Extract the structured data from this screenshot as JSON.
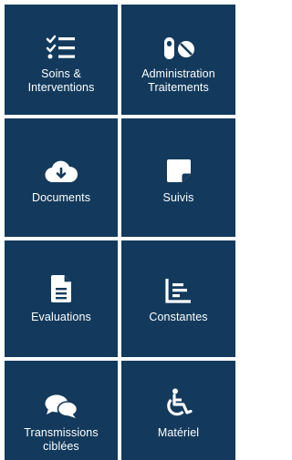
{
  "tiles": [
    {
      "label": "Soins &\nInterventions",
      "icon": "checklist-icon"
    },
    {
      "label": "Administration\nTraitements",
      "icon": "pills-icon"
    },
    {
      "label": "Documents",
      "icon": "cloud-download-icon"
    },
    {
      "label": "Suivis",
      "icon": "sticky-note-icon"
    },
    {
      "label": "Evaluations",
      "icon": "document-icon"
    },
    {
      "label": "Constantes",
      "icon": "bar-chart-icon"
    },
    {
      "label": "Transmissions\nciblées",
      "icon": "chat-bubbles-icon"
    },
    {
      "label": "Matériel",
      "icon": "wheelchair-icon"
    }
  ],
  "colors": {
    "tile": "#133a5c",
    "gutter": "#ffffff",
    "icon": "#ffffff"
  }
}
